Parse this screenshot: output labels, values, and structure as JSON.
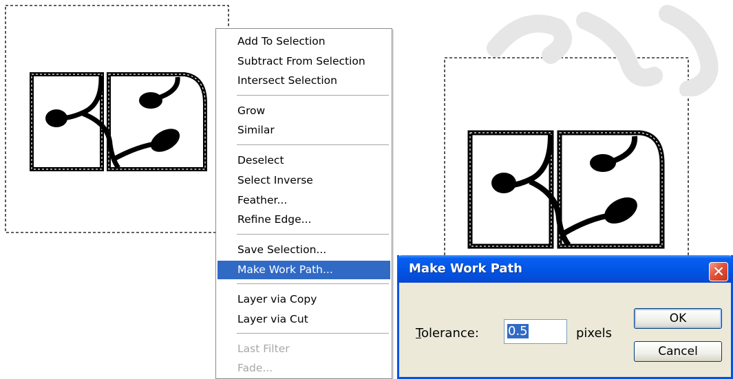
{
  "context_menu": {
    "items": [
      {
        "label": "Add To Selection",
        "state": "normal"
      },
      {
        "label": "Subtract From Selection",
        "state": "normal"
      },
      {
        "label": "Intersect Selection",
        "state": "normal"
      },
      {
        "label": "Grow",
        "state": "normal"
      },
      {
        "label": "Similar",
        "state": "normal"
      },
      {
        "label": "Deselect",
        "state": "normal"
      },
      {
        "label": "Select Inverse",
        "state": "normal"
      },
      {
        "label": "Feather...",
        "state": "normal"
      },
      {
        "label": "Refine Edge...",
        "state": "normal"
      },
      {
        "label": "Save Selection...",
        "state": "normal"
      },
      {
        "label": "Make Work Path...",
        "state": "selected"
      },
      {
        "label": "Layer via Copy",
        "state": "normal"
      },
      {
        "label": "Layer via Cut",
        "state": "normal"
      },
      {
        "label": "Last Filter",
        "state": "disabled"
      },
      {
        "label": "Fade...",
        "state": "disabled"
      }
    ]
  },
  "dialog": {
    "title": "Make Work Path",
    "close_glyph": "✕",
    "tolerance_label_access": "T",
    "tolerance_label_rest": "olerance:",
    "tolerance_value": "0.5",
    "unit": "pixels",
    "ok_label": "OK",
    "cancel_label": "Cancel"
  },
  "colors": {
    "menu_highlight": "#316ac5",
    "title_bar": "#0055e5",
    "dialog_body": "#ece9d8",
    "watermark": "#e6e6e6"
  }
}
